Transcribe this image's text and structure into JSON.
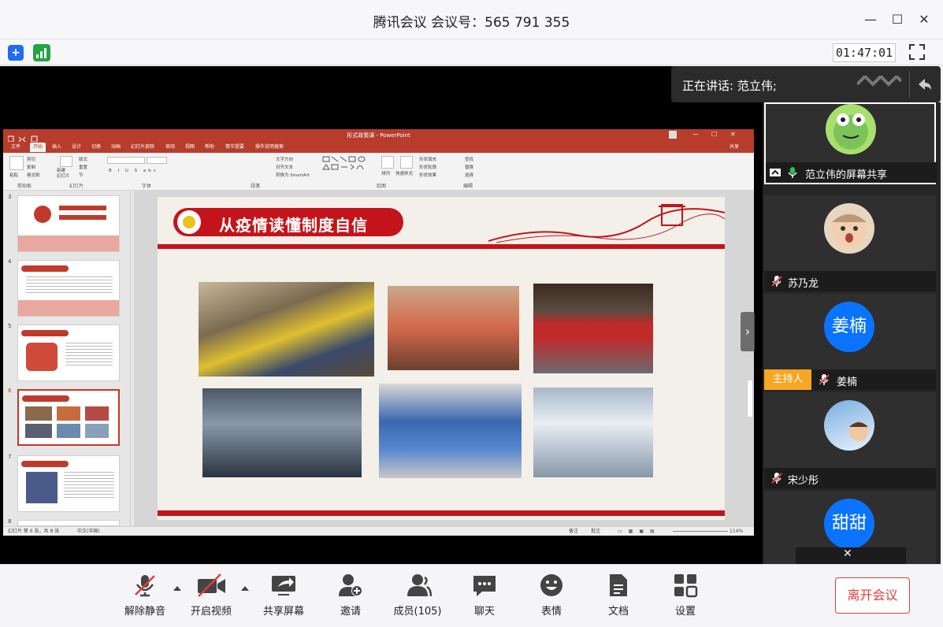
{
  "window": {
    "title": "腾讯会议 会议号：565 791 355",
    "minimize": "—",
    "maximize": "☐",
    "close": "✕"
  },
  "topbar": {
    "timer": "01:47:01"
  },
  "speaking": {
    "label": "正在讲话: 范立伟;"
  },
  "ppt": {
    "title": "形式政策课  -  PowerPoint",
    "tabs": [
      "文件",
      "开始",
      "插入",
      "设计",
      "切换",
      "动画",
      "幻灯片放映",
      "审阅",
      "视图",
      "帮助",
      "操作说明搜索"
    ],
    "share": "共享",
    "ribbon_groups": [
      "剪贴板",
      "幻灯片",
      "字体",
      "段落",
      "绘图",
      "编辑"
    ],
    "ribbon_items": {
      "paste": "粘贴",
      "cut": "剪切",
      "copy": "复制",
      "format_painter": "格式刷",
      "new_slide": "新建\n幻灯片",
      "layout": "版式",
      "reset": "重置",
      "section": "节",
      "text_direction": "文字方向",
      "align_text": "对齐文本",
      "smartart": "转换为 SmartArt",
      "arrange": "排列",
      "quick_styles": "快速样式",
      "shape_fill": "形状填充",
      "shape_outline": "形状轮廓",
      "shape_effect": "形状效果",
      "find": "查找",
      "replace": "替换",
      "select": "选择"
    },
    "thumb_numbers": [
      "3",
      "4",
      "5",
      "6",
      "7",
      "8"
    ],
    "slide_heading": "从疫情读懂制度自信",
    "status_left": "幻灯片 第 6 张，共 8 张",
    "status_lang": "中文(中国)",
    "status_notes": "备注",
    "status_comments": "批注",
    "status_zoom": "114%"
  },
  "participants": [
    {
      "name": "范立伟的屏幕共享",
      "type": "share"
    },
    {
      "name": "苏乃龙",
      "type": "photo"
    },
    {
      "name": "姜楠",
      "avatar_text": "姜楠",
      "host": "主持人",
      "type": "text"
    },
    {
      "name": "宋少彤",
      "type": "photo"
    },
    {
      "name": "",
      "avatar_text": "甜甜",
      "type": "text"
    }
  ],
  "bottombar": {
    "unmute": "解除静音",
    "video": "开启视频",
    "share_screen": "共享屏幕",
    "invite": "邀请",
    "members": "成员(105)",
    "chat": "聊天",
    "emoji": "表情",
    "docs": "文档",
    "settings": "设置",
    "leave": "离开会议"
  },
  "colors": {
    "ppt_red": "#b73c2b",
    "slide_red": "#c4141b",
    "host_orange": "#f5a623",
    "avatar_blue": "#0a73ff",
    "leave_red": "#e03c3c"
  }
}
